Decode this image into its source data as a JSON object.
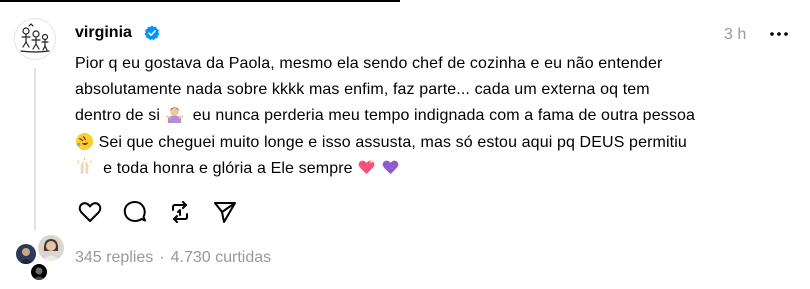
{
  "post": {
    "username": "virginia",
    "timestamp": "3 h",
    "text_lines": [
      "Pior q eu gostava da Paola, mesmo ela sendo chef de cozinha e eu não entender",
      "absolutamente nada sobre kkkk mas enfim, faz parte... cada um externa oq tem",
      "dentro de si",
      "eu nunca perderia meu tempo indignada com a fama de outra pessoa",
      "Sei que cheguei muito longe e isso assusta, mas só estou aqui pq DEUS permitiu",
      "e toda honra e glória a Ele sempre"
    ],
    "emojis": [
      "woman-shrugging-emoji",
      "rolling-laughing-emoji",
      "praying-hands-emoji",
      "sparkling-heart-emoji",
      "purple-heart-emoji"
    ]
  },
  "actions": [
    "like-icon",
    "comment-icon",
    "repost-icon",
    "share-icon"
  ],
  "stats": {
    "replies": "345 replies",
    "separator": "·",
    "likes": "4.730 curtidas"
  },
  "colors": {
    "muted": "#999999",
    "verified": "#0095f6",
    "thread_line": "#e2e2e2"
  }
}
